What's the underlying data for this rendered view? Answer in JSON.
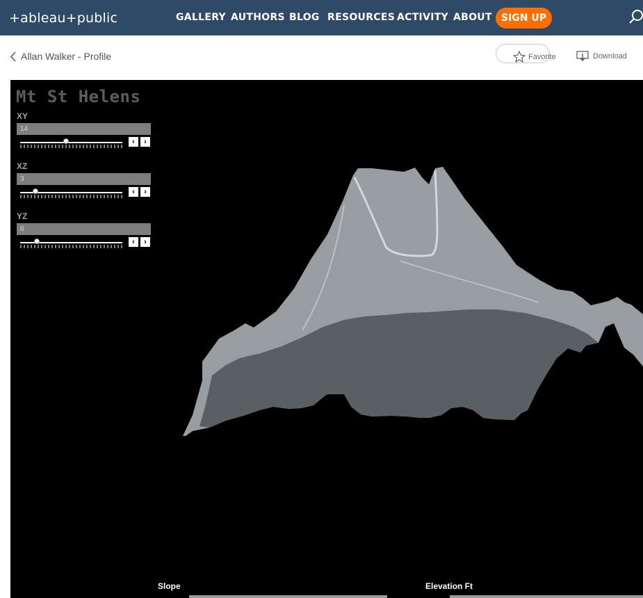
{
  "nav": {
    "logo": "+ableau+public",
    "items": [
      "GALLERY",
      "AUTHORS",
      "BLOG",
      "RESOURCES",
      "ACTIVITY",
      "ABOUT"
    ],
    "signup": "SIGN UP"
  },
  "subbar": {
    "back_label": "Allan Walker - Profile",
    "favorite_label": "Favorite",
    "download_label": "Download"
  },
  "viz": {
    "title": "Mt St Helens",
    "params": [
      {
        "label": "XY",
        "value": "14",
        "level": 0.45
      },
      {
        "label": "XZ",
        "value": "3",
        "level": 0.15
      },
      {
        "label": "YZ",
        "value": "6",
        "level": 0.16
      }
    ],
    "legend": {
      "slope": "Slope",
      "elevation": "Elevation Ft"
    }
  },
  "colors": {
    "nav_bg": "#2e4a66",
    "signup_bg": "#ff6f00",
    "viz_bg": "#000000",
    "mountain": "#c8ccd0"
  }
}
